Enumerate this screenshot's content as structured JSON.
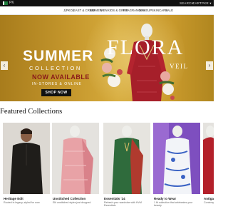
{
  "topbar": {
    "country": "PK",
    "search": "SEARCH",
    "cart": "CART",
    "currency": "PKR ▾"
  },
  "nav": {
    "items": [
      "J(PKO)",
      "EAST & CREW",
      "WOMEN",
      "MEN",
      "KIDS & GIRLS",
      "FRAGRANCES",
      "MAKEUP",
      "SKINCARE",
      "SALE"
    ]
  },
  "hero": {
    "headline": "SUMMER",
    "subheadline": "COLLECTION",
    "availability": "NOW AVAILABLE",
    "channels": "IN-STORES & ONLINE",
    "cta": "SHOP NOW",
    "brand_title": "FLORA",
    "brand_subtitle": "VEIL",
    "prev_arrow": "‹",
    "next_arrow": "›"
  },
  "featured": {
    "title": "Featured Collections",
    "cards": [
      {
        "title": "Heritage Edit",
        "desc": "Rooted in legacy, styled for now"
      },
      {
        "title": "Unstitched Collection",
        "desc": "Elit unstitched styles just dropped"
      },
      {
        "title": "Essentials '24",
        "desc": "Refresh your wardrobe with HVM Essentials"
      },
      {
        "title": "Ready to Wear",
        "desc": "1 fit collection that celebrates your beauty"
      },
      {
        "title": "Antiga",
        "desc": "Contemporary"
      }
    ]
  },
  "colors": {
    "hero_gold": "#c7992e",
    "accent_red": "#8a1a1a",
    "dark": "#111111"
  }
}
